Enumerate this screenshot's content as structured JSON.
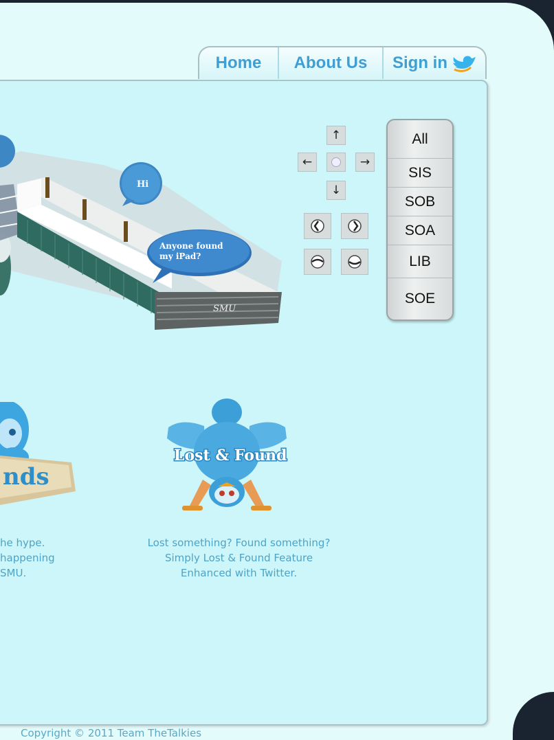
{
  "nav": {
    "home": "Home",
    "about": "About Us",
    "signin": "Sign in"
  },
  "map": {
    "bubble_hi": "Hi",
    "bubble_ipad_line1": "Anyone found",
    "bubble_ipad_line2": "my iPad?",
    "building_label": "SMU"
  },
  "filter": {
    "items": [
      "All",
      "SIS",
      "SOB",
      "SOA",
      "LIB",
      "SOE"
    ]
  },
  "controls": {
    "up": "↑",
    "left": "←",
    "right": "→",
    "down": "↓"
  },
  "features": {
    "left_badge": "nds",
    "left_desc": [
      "he hype.",
      "happening",
      "SMU."
    ],
    "lost_found_title": "Lost & Found",
    "lost_found_desc": [
      "Lost something? Found something?",
      "Simply Lost & Found Feature",
      "Enhanced with Twitter."
    ]
  },
  "footer": {
    "copyright": "Copyright © 2011 Team TheTalkies"
  },
  "colors": {
    "accent": "#3f9ed2",
    "panel": "#ccf6f9",
    "background": "#1a2431"
  }
}
